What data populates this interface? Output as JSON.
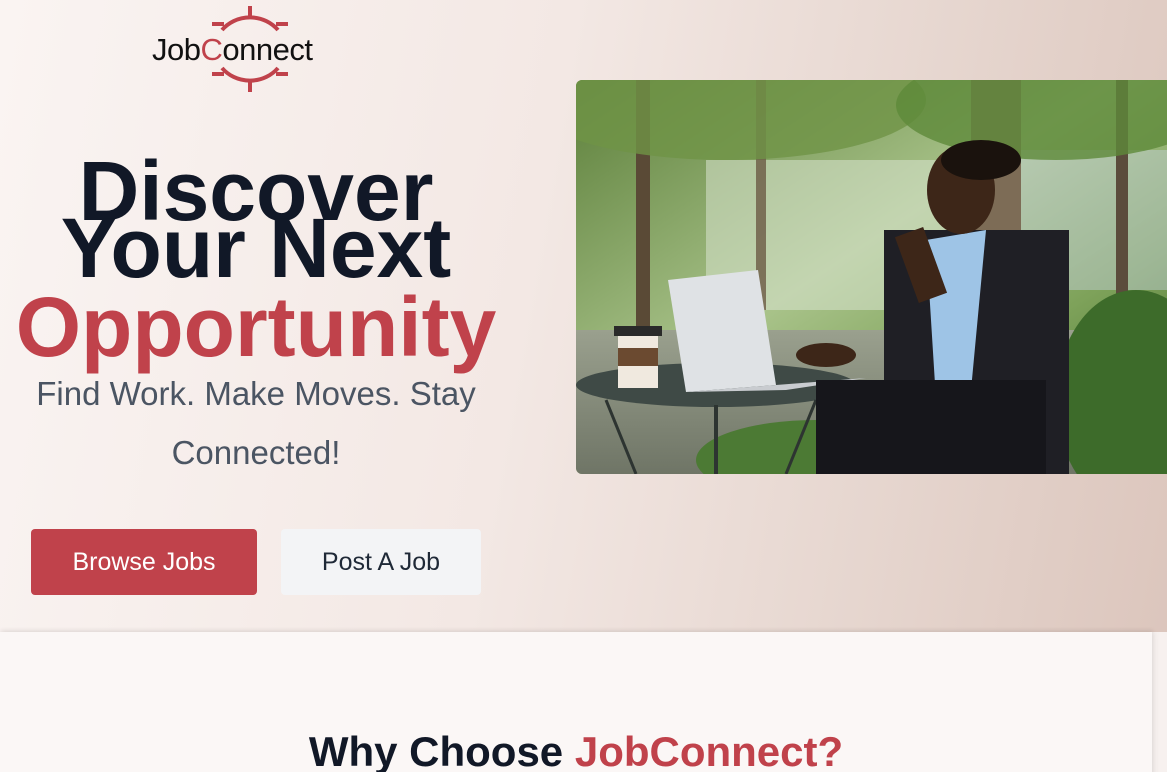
{
  "logo": {
    "text_prefix": "Job",
    "text_accent": "C",
    "text_suffix": "onnect"
  },
  "hero": {
    "headline_line1": "Discover",
    "headline_line2": "Your Next",
    "headline_line3": "Opportunity",
    "tagline": "Find Work. Make Moves. Stay Connected!",
    "primary_button": "Browse Jobs",
    "secondary_button": "Post A Job",
    "image_alt": "Man in a suit talking on the phone while using a laptop at an outdoor table in a park",
    "image_icon": "photo-icon"
  },
  "features": {
    "heading_prefix": "Why Choose ",
    "heading_brand": "JobConnect?"
  },
  "colors": {
    "accent": "#c0424b",
    "headline": "#111827",
    "tagline": "#4b5563",
    "secondary_button_bg": "#f3f4f6"
  }
}
